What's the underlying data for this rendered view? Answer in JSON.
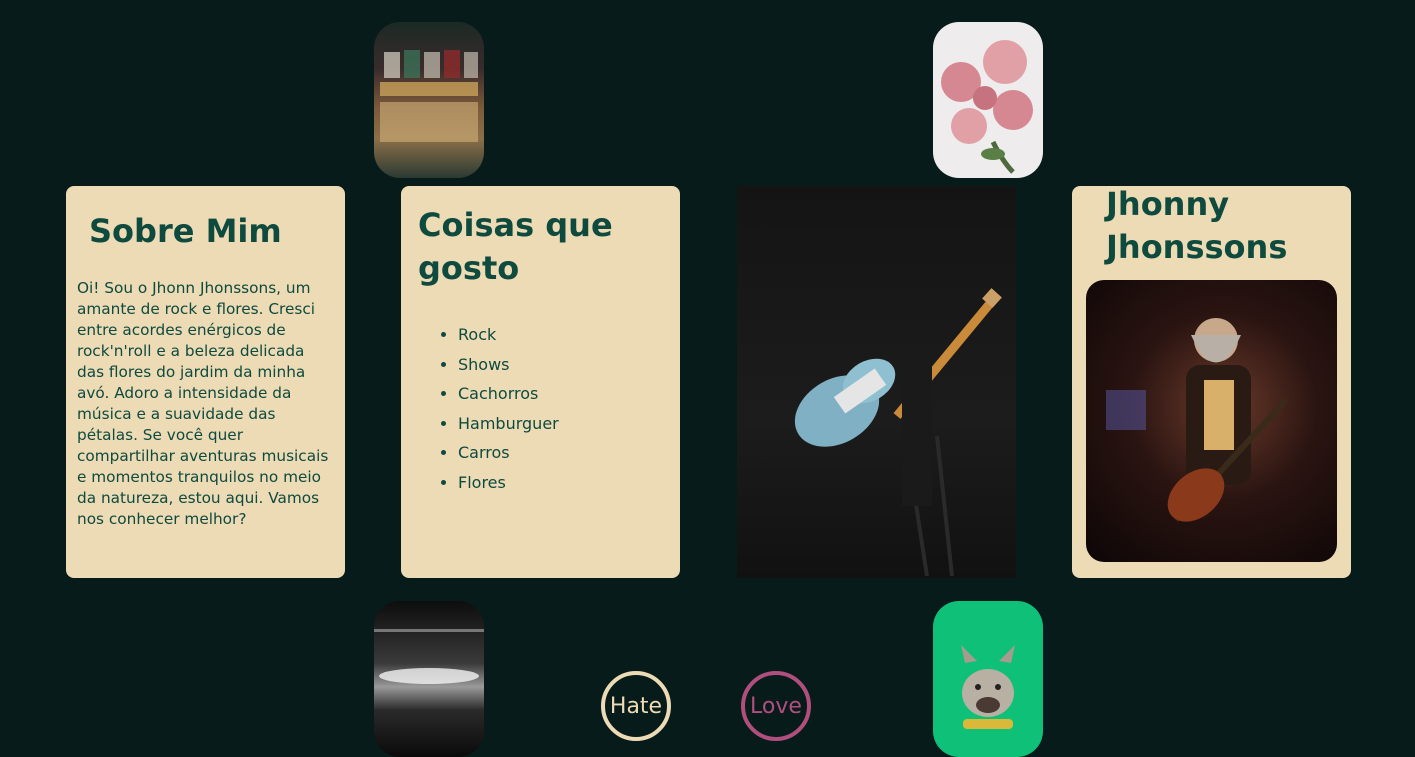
{
  "about": {
    "title": "Sobre Mim",
    "text": "Oi! Sou o Jhonn Jhonssons, um amante de rock e flores. Cresci entre acordes enérgicos de rock'n'roll e a beleza delicada das flores do jardim da minha avó. Adoro a intensidade da música e a suavidade das pétalas. Se você quer compartilhar aventuras musicais e momentos tranquilos no meio da natureza, estou aqui. Vamos nos conhecer melhor?"
  },
  "likes": {
    "title": "Coisas que gosto",
    "items": [
      "Rock",
      "Shows",
      "Cachorros",
      "Hamburguer",
      "Carros",
      "Flores"
    ]
  },
  "profile": {
    "name": "Jhonny Jhonssons"
  },
  "buttons": {
    "hate": "Hate",
    "love": "Love"
  },
  "colors": {
    "background": "#071b1a",
    "card": "#ecdbb5",
    "text": "#0f4a3f",
    "hate": "#ecdbb5",
    "love": "#b04f7d"
  }
}
